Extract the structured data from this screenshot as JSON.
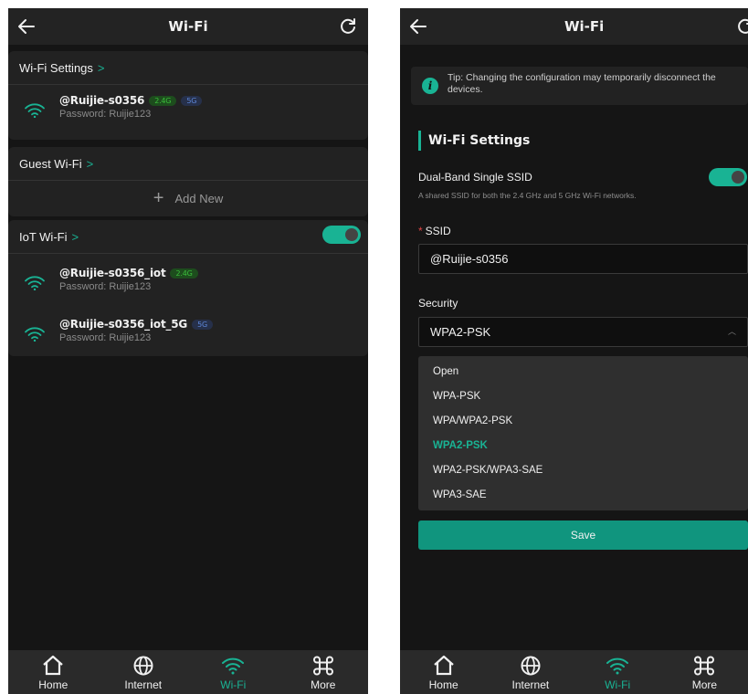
{
  "left": {
    "header": {
      "title": "Wi-Fi"
    },
    "wifi_settings": {
      "title": "Wi-Fi Settings",
      "ssid": {
        "name": "@Ruijie-s0356",
        "badges": [
          "2.4G",
          "5G"
        ],
        "password": "Password: Ruijie123"
      }
    },
    "guest_wifi": {
      "title": "Guest Wi-Fi",
      "add_new": "Add New"
    },
    "iot_wifi": {
      "title": "IoT Wi-Fi",
      "enabled": true,
      "ssids": [
        {
          "name": "@Ruijie-s0356_iot",
          "badge": "2.4G",
          "password": "Password: Ruijie123"
        },
        {
          "name": "@Ruijie-s0356_iot_5G",
          "badge": "5G",
          "password": "Password: Ruijie123"
        }
      ]
    }
  },
  "right": {
    "header": {
      "title": "Wi-Fi"
    },
    "tip": "Tip: Changing the configuration may temporarily disconnect the devices.",
    "settings_title": "Wi-Fi Settings",
    "dual_band": {
      "label": "Dual-Band Single SSID",
      "description": "A shared SSID for both the 2.4 GHz and 5 GHz Wi-Fi networks.",
      "enabled": true
    },
    "ssid": {
      "label": "SSID",
      "required_mark": "*",
      "value": "@Ruijie-s0356"
    },
    "security": {
      "label": "Security",
      "value": "WPA2-PSK",
      "options": [
        "Open",
        "WPA-PSK",
        "WPA/WPA2-PSK",
        "WPA2-PSK",
        "WPA2-PSK/WPA3-SAE",
        "WPA3-SAE"
      ],
      "selected_index": 3
    },
    "save_label": "Save"
  },
  "tabbar": {
    "tabs": [
      {
        "label": "Home",
        "icon": "home-icon"
      },
      {
        "label": "Internet",
        "icon": "globe-icon"
      },
      {
        "label": "Wi-Fi",
        "icon": "wifi-icon",
        "active": true
      },
      {
        "label": "More",
        "icon": "command-icon"
      }
    ]
  },
  "colors": {
    "accent": "#19b394",
    "background": "#151515",
    "card": "#222222",
    "badge_24g": "#3bbd3b",
    "badge_5g": "#5d86d8"
  }
}
